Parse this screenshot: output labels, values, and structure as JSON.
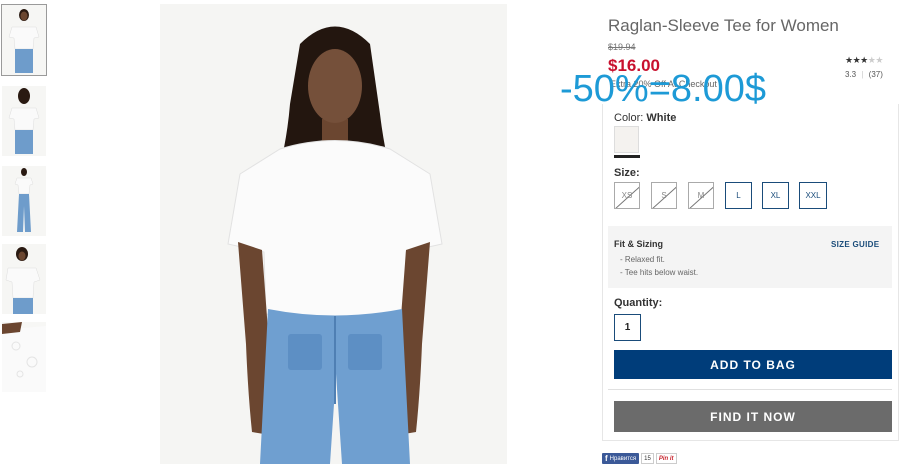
{
  "product": {
    "title": "Raglan-Sleeve Tee for Women",
    "original_price": "$19.94",
    "price": "$16.00",
    "promo": "Extra 20% Off At Checkout",
    "rating_value": 0.7,
    "rating_text": "3.3",
    "review_count": "(37)"
  },
  "overlay_text": "-50%=8.00$",
  "color": {
    "label": "Color:",
    "value": "White",
    "swatch": "#f4f2ef"
  },
  "size": {
    "label": "Size:",
    "options": [
      {
        "label": "XS",
        "available": false
      },
      {
        "label": "S",
        "available": false
      },
      {
        "label": "M",
        "available": false
      },
      {
        "label": "L",
        "available": true
      },
      {
        "label": "XL",
        "available": true
      },
      {
        "label": "XXL",
        "available": true
      }
    ]
  },
  "fit": {
    "title": "Fit & Sizing",
    "guide_link": "SIZE GUIDE",
    "items": [
      "- Relaxed fit.",
      "- Tee hits below waist."
    ]
  },
  "quantity": {
    "label": "Quantity:",
    "value": "1"
  },
  "buttons": {
    "add_to_bag": "ADD TO BAG",
    "find_it_now": "FIND IT NOW"
  },
  "social": {
    "facebook": "Нравится",
    "facebook_count": "15",
    "pinterest": "Pin it"
  },
  "colors": {
    "price_red": "#c8102e",
    "navy": "#003d7a",
    "overlay_blue": "#1d9ad6",
    "gray_button": "#6b6b6b"
  },
  "icons": {
    "rating": "star-icon",
    "facebook": "facebook-icon"
  }
}
